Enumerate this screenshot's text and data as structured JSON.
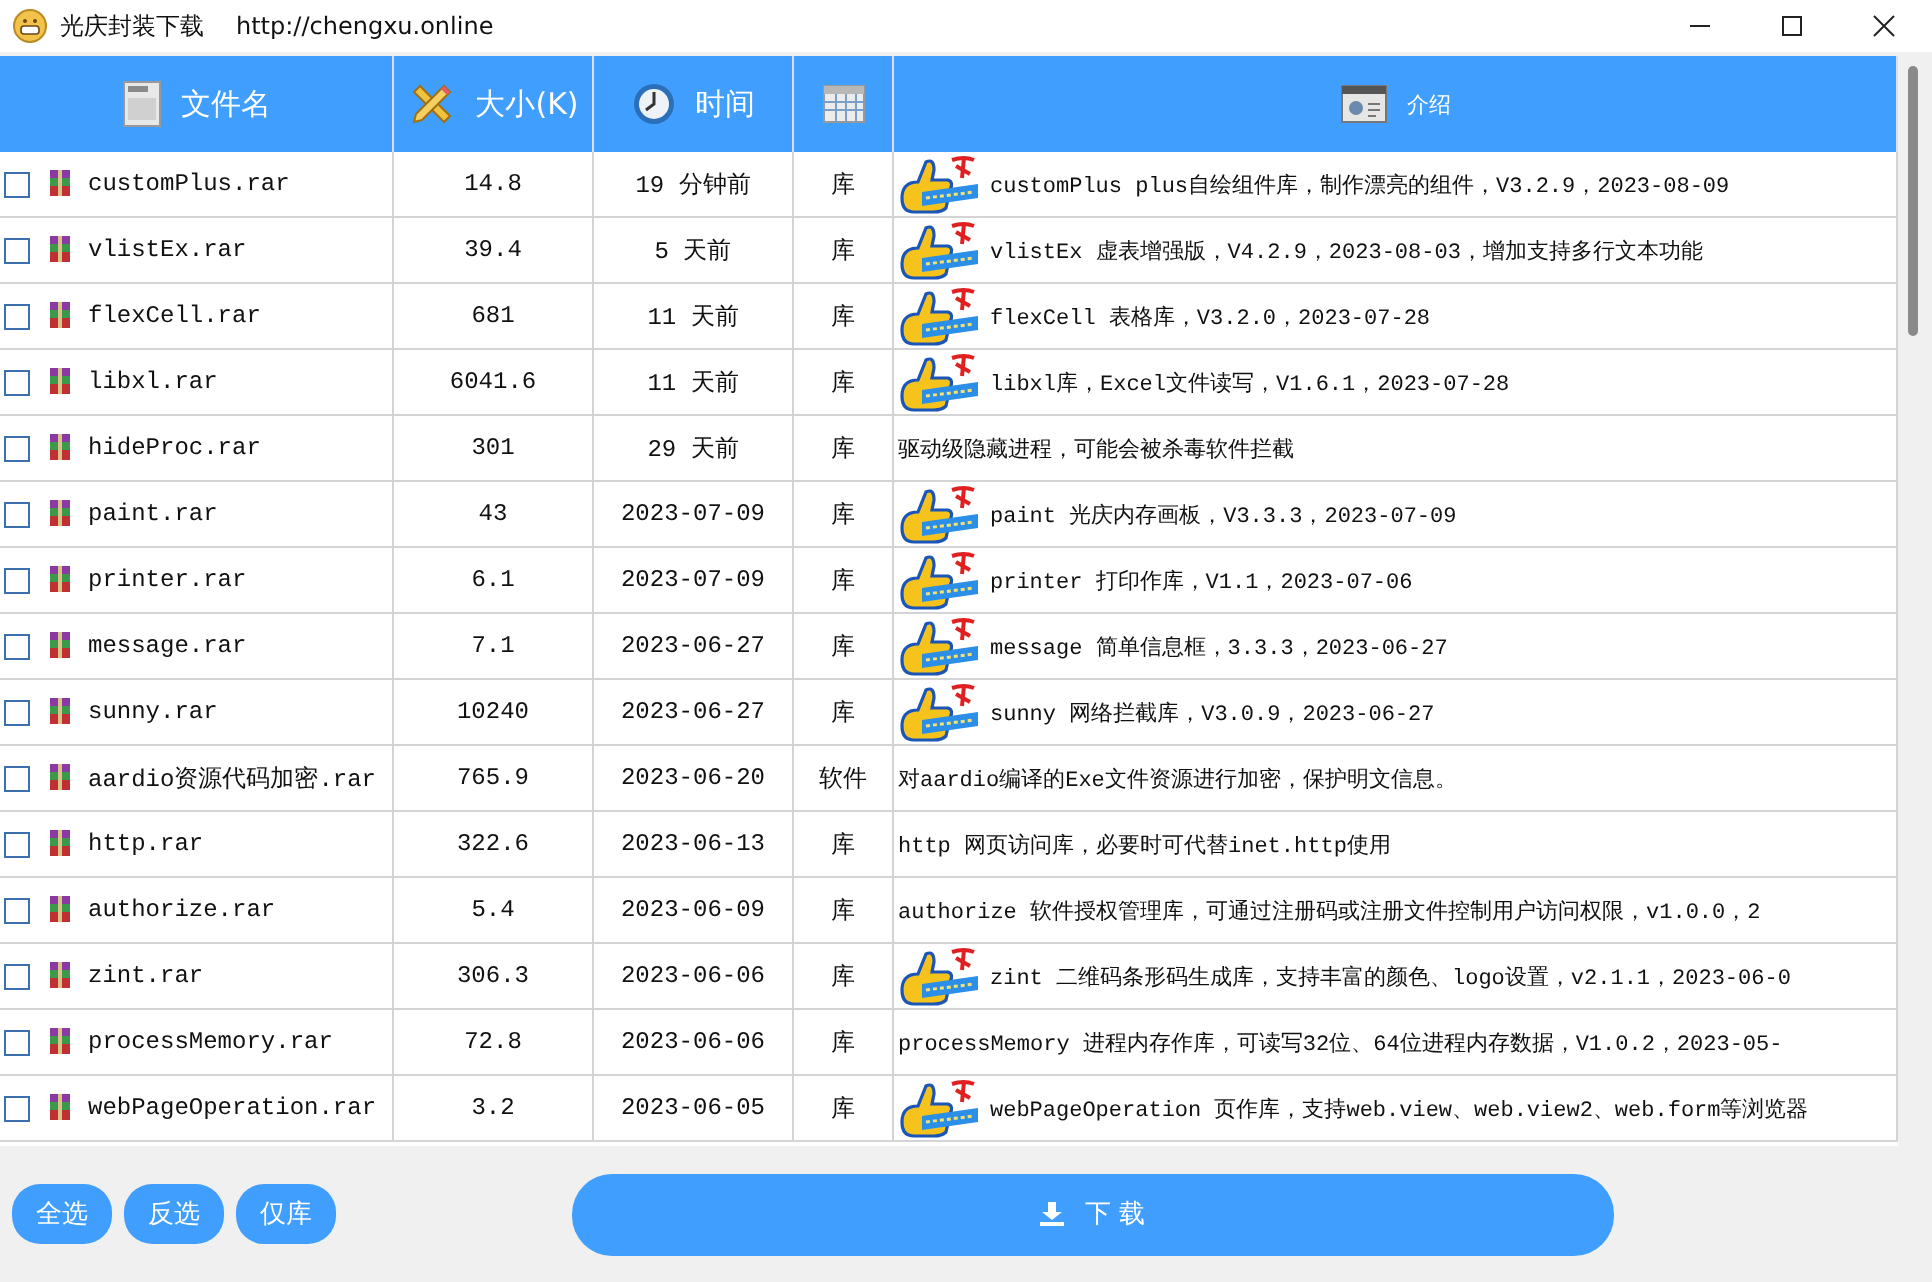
{
  "window": {
    "title": "光庆封装下载",
    "url": "http://chengxu.online"
  },
  "table": {
    "columns": [
      {
        "kind": "file",
        "label": "文件名"
      },
      {
        "kind": "size",
        "label": "大小(K)"
      },
      {
        "kind": "time",
        "label": "时间"
      },
      {
        "kind": "grid"
      },
      {
        "kind": "intro",
        "label": "介绍"
      }
    ],
    "rows": [
      {
        "checked": false,
        "name": "customPlus.rar",
        "size": "14.8",
        "time": "19 分钟前",
        "type": "库",
        "recommended": true,
        "description": "customPlus plus自绘组件库，制作漂亮的组件，V3.2.9，2023-08-09"
      },
      {
        "checked": false,
        "name": "vlistEx.rar",
        "size": "39.4",
        "time": "5 天前",
        "type": "库",
        "recommended": true,
        "description": "vlistEx 虚表增强版，V4.2.9，2023-08-03，增加支持多行文本功能"
      },
      {
        "checked": false,
        "name": "flexCell.rar",
        "size": "681",
        "time": "11 天前",
        "type": "库",
        "recommended": true,
        "description": "flexCell 表格库，V3.2.0，2023-07-28"
      },
      {
        "checked": false,
        "name": "libxl.rar",
        "size": "6041.6",
        "time": "11 天前",
        "type": "库",
        "recommended": true,
        "description": "libxl库，Excel文件读写，V1.6.1，2023-07-28"
      },
      {
        "checked": false,
        "name": "hideProc.rar",
        "size": "301",
        "time": "29 天前",
        "type": "库",
        "recommended": false,
        "description": "驱动级隐藏进程，可能会被杀毒软件拦截"
      },
      {
        "checked": false,
        "name": "paint.rar",
        "size": "43",
        "time": "2023-07-09",
        "type": "库",
        "recommended": true,
        "description": "paint 光庆内存画板，V3.3.3，2023-07-09"
      },
      {
        "checked": false,
        "name": "printer.rar",
        "size": "6.1",
        "time": "2023-07-09",
        "type": "库",
        "recommended": true,
        "description": "printer 打印作库，V1.1，2023-07-06"
      },
      {
        "checked": false,
        "name": "message.rar",
        "size": "7.1",
        "time": "2023-06-27",
        "type": "库",
        "recommended": true,
        "description": "message 简单信息框，3.3.3，2023-06-27"
      },
      {
        "checked": false,
        "name": "sunny.rar",
        "size": "10240",
        "time": "2023-06-27",
        "type": "库",
        "recommended": true,
        "description": "sunny 网络拦截库，V3.0.9，2023-06-27"
      },
      {
        "checked": false,
        "name": "aardio资源代码加密.rar",
        "size": "765.9",
        "time": "2023-06-20",
        "type": "软件",
        "recommended": false,
        "description": "对aardio编译的Exe文件资源进行加密，保护明文信息。"
      },
      {
        "checked": false,
        "name": "http.rar",
        "size": "322.6",
        "time": "2023-06-13",
        "type": "库",
        "recommended": false,
        "description": "http 网页访问库，必要时可代替inet.http使用"
      },
      {
        "checked": false,
        "name": "authorize.rar",
        "size": "5.4",
        "time": "2023-06-09",
        "type": "库",
        "recommended": false,
        "description": "authorize 软件授权管理库，可通过注册码或注册文件控制用户访问权限，v1.0.0，2"
      },
      {
        "checked": false,
        "name": "zint.rar",
        "size": "306.3",
        "time": "2023-06-06",
        "type": "库",
        "recommended": true,
        "description": "zint 二维码条形码生成库，支持丰富的颜色、logo设置，v2.1.1，2023-06-0"
      },
      {
        "checked": false,
        "name": "processMemory.rar",
        "size": "72.8",
        "time": "2023-06-06",
        "type": "库",
        "recommended": false,
        "description": "processMemory 进程内存作库，可读写32位、64位进程内存数据，V1.0.2，2023-05-"
      },
      {
        "checked": false,
        "name": "webPageOperation.rar",
        "size": "3.2",
        "time": "2023-06-05",
        "type": "库",
        "recommended": true,
        "description": "webPageOperation 页作库，支持web.view、web.view2、web.form等浏览器"
      }
    ]
  },
  "buttons": [
    "全选",
    "反选",
    "仅库"
  ],
  "download_button": "下 载"
}
